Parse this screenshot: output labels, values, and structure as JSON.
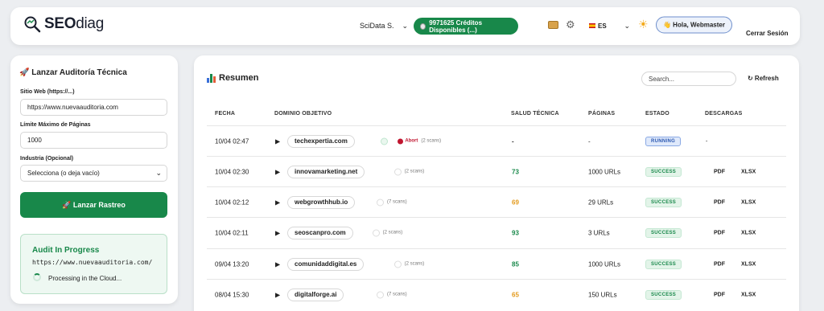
{
  "header": {
    "logo_bold": "SEO",
    "logo_light": "diag",
    "account": "SciData S.",
    "credits": "9971625 Créditos Disponibles (...)",
    "language": "ES",
    "greeting": "👋 Hola, Webmaster",
    "logout": "Cerrar Sesión"
  },
  "audit_form": {
    "title": "🚀 Lanzar Auditoría Técnica",
    "site_label": "Sitio Web (https://...)",
    "site_value": "https://www.nuevaauditoria.com",
    "limit_label": "Límite Máximo de Páginas",
    "limit_value": "1000",
    "industry_label": "Industria (Opcional)",
    "industry_value": "Selecciona (o deja vacío)",
    "launch_label": "🚀 Lanzar Rastreo"
  },
  "progress": {
    "title": "Audit In Progress",
    "url": "https://www.nuevaauditoria.com/",
    "status": "Processing in the Cloud..."
  },
  "summary": {
    "title": "Resumen",
    "search_placeholder": "Search...",
    "refresh_label": "↻ Refresh",
    "columns": [
      "FECHA",
      "DOMINIO OBJETIVO",
      "SALUD TÉCNICA",
      "PÁGINAS",
      "ESTADO",
      "DESCARGAS"
    ],
    "rows": [
      {
        "date": "10/04 02:47",
        "domain": "techexpertia.com",
        "scans": "(2 scans)",
        "abort": "Abort",
        "health": "-",
        "pages": "-",
        "status": "RUNNING",
        "dl_pdf": "",
        "dl_xlsx": "",
        "dl_dash": "-",
        "health_color": "#333333"
      },
      {
        "date": "10/04 02:30",
        "domain": "innovamarketing.net",
        "scans": "(2 scans)",
        "abort": "",
        "health": "73",
        "pages": "1000 URLs",
        "status": "SUCCESS",
        "dl_pdf": "PDF",
        "dl_xlsx": "XLSX",
        "dl_dash": "",
        "health_color": "#18884a"
      },
      {
        "date": "10/04 02:12",
        "domain": "webgrowthhub.io",
        "scans": "(7 scans)",
        "abort": "",
        "health": "69",
        "pages": "29 URLs",
        "status": "SUCCESS",
        "dl_pdf": "PDF",
        "dl_xlsx": "XLSX",
        "dl_dash": "",
        "health_color": "#e39a1c"
      },
      {
        "date": "10/04 02:11",
        "domain": "seoscanpro.com",
        "scans": "(2 scans)",
        "abort": "",
        "health": "93",
        "pages": "3 URLs",
        "status": "SUCCESS",
        "dl_pdf": "PDF",
        "dl_xlsx": "XLSX",
        "dl_dash": "",
        "health_color": "#18884a"
      },
      {
        "date": "09/04 13:20",
        "domain": "comunidaddigital.es",
        "scans": "(2 scans)",
        "abort": "",
        "health": "85",
        "pages": "1000 URLs",
        "status": "SUCCESS",
        "dl_pdf": "PDF",
        "dl_xlsx": "XLSX",
        "dl_dash": "",
        "health_color": "#18884a"
      },
      {
        "date": "08/04 15:30",
        "domain": "digitalforge.ai",
        "scans": "(7 scans)",
        "abort": "",
        "health": "65",
        "pages": "150 URLs",
        "status": "SUCCESS",
        "dl_pdf": "PDF",
        "dl_xlsx": "XLSX",
        "dl_dash": "",
        "health_color": "#e39a1c"
      }
    ]
  },
  "colors": {
    "brand_green": "#18884a",
    "running_blue": "#2a57b0",
    "abort_red": "#c0152f",
    "warn_orange": "#e39a1c"
  }
}
